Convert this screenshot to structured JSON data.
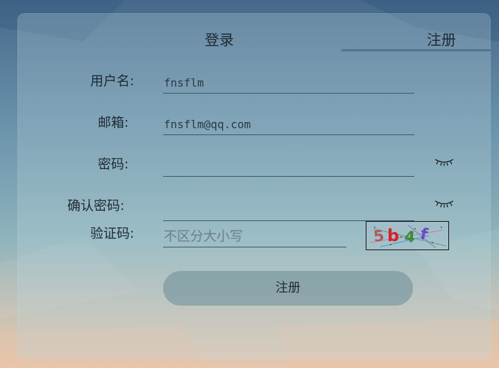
{
  "tabs": {
    "login": "登录",
    "register": "注册"
  },
  "form": {
    "username_label": "用户名:",
    "username_value": "fnsflm",
    "email_label": "邮箱:",
    "email_value": "fnsflm@qq.com",
    "password_label": "密码:",
    "password_value": "",
    "confirm_label": "确认密码:",
    "confirm_value": "",
    "captcha_label": "验证码:",
    "captcha_placeholder": "不区分大小写",
    "submit_label": "注册"
  },
  "captcha_image": {
    "chars": [
      "5",
      "b",
      "4",
      "f"
    ],
    "colors": [
      "#b05a5a",
      "#d8202a",
      "#3a8a3a",
      "#6a4cc4"
    ]
  },
  "icons": {
    "password_toggle": "eye-closed-icon",
    "confirm_toggle": "eye-closed-icon"
  }
}
